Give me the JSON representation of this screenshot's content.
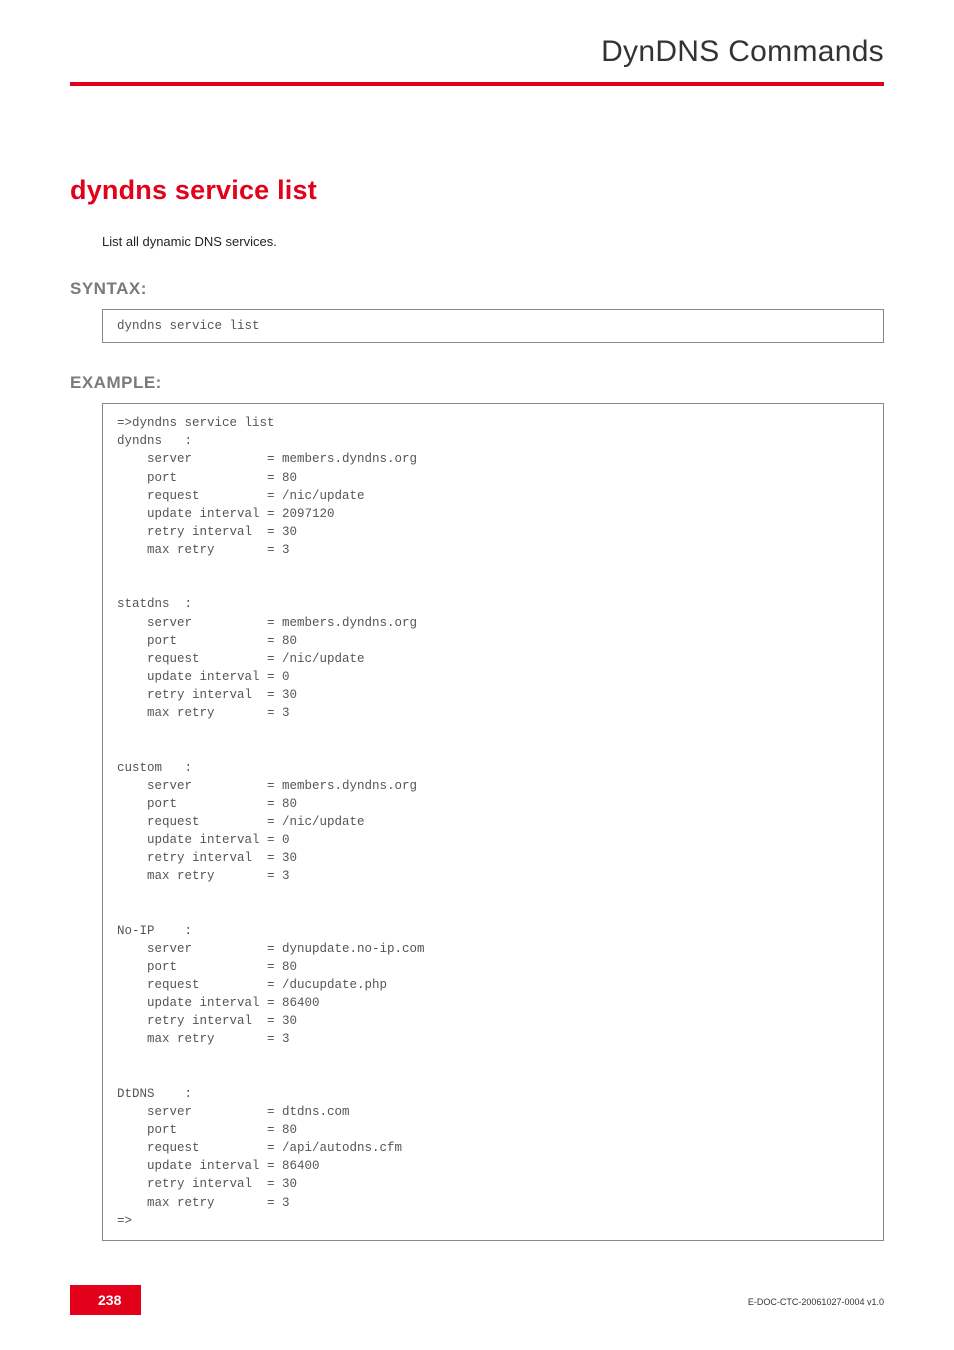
{
  "header": {
    "title": "DynDNS Commands"
  },
  "page": {
    "title": "dyndns service list",
    "description": "List all dynamic DNS services."
  },
  "syntax": {
    "heading": "SYNTAX:",
    "code": "dyndns service list"
  },
  "example": {
    "heading": "EXAMPLE:",
    "code": "=>dyndns service list\ndyndns   :\n    server          = members.dyndns.org\n    port            = 80\n    request         = /nic/update\n    update interval = 2097120\n    retry interval  = 30\n    max retry       = 3\n\n\nstatdns  :\n    server          = members.dyndns.org\n    port            = 80\n    request         = /nic/update\n    update interval = 0\n    retry interval  = 30\n    max retry       = 3\n\n\ncustom   :\n    server          = members.dyndns.org\n    port            = 80\n    request         = /nic/update\n    update interval = 0\n    retry interval  = 30\n    max retry       = 3\n\n\nNo-IP    :\n    server          = dynupdate.no-ip.com\n    port            = 80\n    request         = /ducupdate.php\n    update interval = 86400\n    retry interval  = 30\n    max retry       = 3\n\n\nDtDNS    :\n    server          = dtdns.com\n    port            = 80\n    request         = /api/autodns.cfm\n    update interval = 86400\n    retry interval  = 30\n    max retry       = 3\n=>"
  },
  "footer": {
    "page_number": "238",
    "doc_id": "E-DOC-CTC-20061027-0004 v1.0"
  }
}
